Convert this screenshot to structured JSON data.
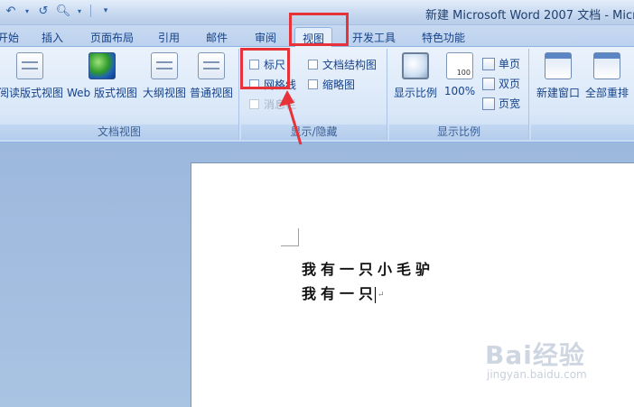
{
  "window": {
    "title": "新建 Microsoft Word 2007 文档 - Micro"
  },
  "qat": {
    "undo_icon": "undo-icon",
    "redo_icon": "redo-icon",
    "preview_icon": "print-preview-icon",
    "dropdown_icon": "chevron-down-icon"
  },
  "tabs": [
    {
      "label": "开始"
    },
    {
      "label": "插入"
    },
    {
      "label": "页面布局"
    },
    {
      "label": "引用"
    },
    {
      "label": "邮件"
    },
    {
      "label": "审阅"
    },
    {
      "label": "视图",
      "active": true
    },
    {
      "label": "开发工具"
    },
    {
      "label": "特色功能"
    }
  ],
  "groups": {
    "views": {
      "label": "文档视图",
      "buttons": [
        "阅读版式视图",
        "Web 版式视图",
        "大纲视图",
        "普通视图"
      ]
    },
    "show_hide": {
      "label": "显示/隐藏",
      "ruler": "标尺",
      "gridlines": "网格线",
      "message_bar": "消息栏",
      "doc_map": "文档结构图",
      "thumbnails": "缩略图"
    },
    "zoom": {
      "label": "显示比例",
      "zoom_btn": "显示比例",
      "hundred": "100%",
      "one_page": "单页",
      "two_pages": "双页",
      "page_width": "页宽"
    },
    "window": {
      "new_window": "新建窗口",
      "arrange_all": "全部重排"
    }
  },
  "document": {
    "lines": [
      "我有一只小毛驴",
      "我有一只"
    ],
    "paragraph_mark": "↵"
  },
  "watermark": {
    "main": "Bai经验",
    "sub": "jingyan.baidu.com"
  },
  "colors": {
    "highlight": "#e8323a",
    "ribbon": "#dbe7f7",
    "page": "#ffffff"
  }
}
